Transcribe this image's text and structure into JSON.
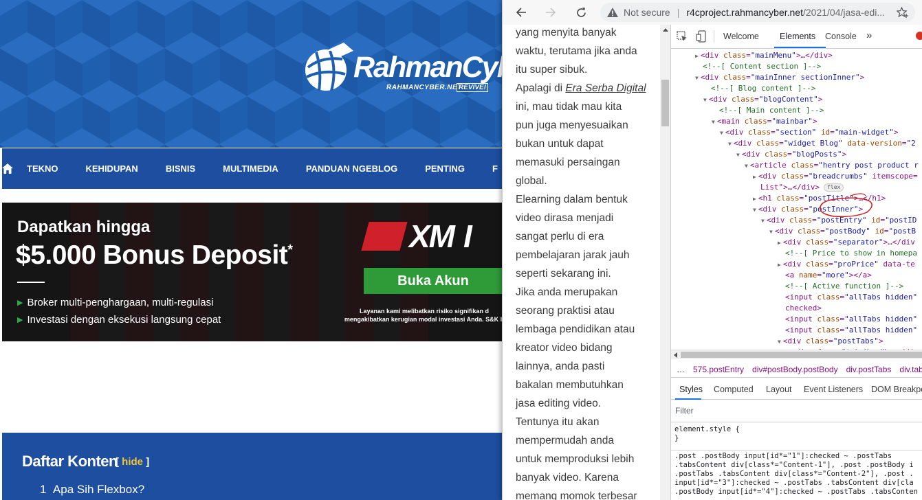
{
  "site": {
    "logo_text": "RahmanCyber",
    "logo_sub": "RAHMANCYBER.NET",
    "logo_revive": "REVIVE!",
    "nav": [
      "TEKNO",
      "KEHIDUPAN",
      "BISNIS",
      "MULTIMEDIA",
      "PANDUAN NGEBLOG",
      "PENTING",
      "F"
    ],
    "ad": {
      "line1": "Dapatkan hingga",
      "line2": "$5.000 Bonus Deposit",
      "star": "*",
      "bullets": [
        "Broker multi-penghargaan, multi-regulasi",
        "Investasi dengan eksekusi langsung cepat"
      ],
      "brand": "XM",
      "brand_suffix": "I",
      "cta": "Buka Akun",
      "disclaimer1": "Layanan kami melibatkan risiko signifikan d",
      "disclaimer2": "mengakibatkan kerugian modal investasi Anda. S&K b"
    },
    "toc": {
      "title": "Daftar Konten",
      "hide_open": "[",
      "hide_label": "hide",
      "hide_close": "]",
      "item1_num": "1",
      "item1_label": "Apa Sih Flexbox?"
    }
  },
  "browser": {
    "not_secure": "Not secure",
    "url_domain": "r4cproject.rahmancyber.net",
    "url_path": "/2021/04/jasa-edi..."
  },
  "reader_lines": [
    "yang menyita banyak",
    "waktu, terutama jika anda",
    "itu super sibuk.",
    "Apalagi di |Era Serba Digital",
    "ini, mau tidak mau kita",
    "pun juga menyesuaikan",
    "bukan untuk dapat",
    "memasuki persaingan",
    "global.",
    "Elearning dalam bentuk",
    "video dirasa menjadi",
    "sangat perlu di era",
    "pembelajaran jarak jauh",
    "seperti sekarang ini.",
    "Jika anda merupakan",
    "seorang praktisi atau",
    "lembaga pendidikan atau",
    "kreator video bidang",
    "lainnya, anda pasti",
    "bakalan membutuhkan",
    "jasa editing video.",
    "Tentunya itu akan",
    "mempermudah anda",
    "untuk memproduksi lebih",
    "banyak video. Karena",
    "memang momok terbesar"
  ],
  "devtools": {
    "tabs": [
      "Welcome",
      "Elements",
      "Console",
      "»"
    ],
    "dom_lines": [
      {
        "t": "tag",
        "text": "<div class=\"mainMenu\">…</div>",
        "indent": 0
      },
      {
        "t": "cm",
        "text": "<!--[ Content section ]-->",
        "indent": 0
      },
      {
        "t": "tag",
        "text": "<div class=\"mainInner sectionInner\">",
        "indent": 0
      },
      {
        "t": "cm",
        "text": "<!--[ Blog content ]-->",
        "indent": 1
      },
      {
        "t": "tag",
        "text": "<div class=\"blogContent\">",
        "indent": 1
      },
      {
        "t": "cm",
        "text": "<!--[ Main content ]-->",
        "indent": 2
      },
      {
        "t": "tag",
        "text": "<main class=\"mainbar\">",
        "indent": 2
      },
      {
        "t": "tag",
        "text": "<div class=\"section\" id=\"main-widget\">",
        "indent": 3
      },
      {
        "t": "tag",
        "text": "<div class=\"widget Blog\" data-version=\"2",
        "indent": 4
      },
      {
        "t": "tag",
        "text": "<div class=\"blogPosts\">",
        "indent": 5
      },
      {
        "t": "tag",
        "text": "<article class=\"hentry post product r",
        "indent": 6
      },
      {
        "t": "tag",
        "text": "<div class=\"breadcrumbs\" itemscope=",
        "indent": 7
      },
      {
        "t": "tx",
        "text": "List\">…</div>",
        "indent": 7
      },
      {
        "t": "tag",
        "text": "<h1 class=\"postTitle\">…</h1>",
        "indent": 7
      },
      {
        "t": "tag",
        "text": "<div class=\"postInner\">",
        "indent": 7
      },
      {
        "t": "tag",
        "text": "<div class=\"postEntry\" id=\"postID",
        "indent": 8
      },
      {
        "t": "tag",
        "text": "<div class=\"postBody\" id=\"postB",
        "indent": 9
      },
      {
        "t": "tag",
        "text": "<div class=\"separator\">…</div",
        "indent": 10
      },
      {
        "t": "cm",
        "text": "<!--[ Price to show in homepa",
        "indent": 10
      },
      {
        "t": "tag",
        "text": "<div class=\"proPrice\" data-te",
        "indent": 10
      },
      {
        "t": "tag",
        "text": "<a name=\"more\"></a>",
        "indent": 10
      },
      {
        "t": "cm",
        "text": "<!--[ Active function ]-->",
        "indent": 10
      },
      {
        "t": "tag",
        "text": "<input class=\"allTabs hidden\"",
        "indent": 10
      },
      {
        "t": "tx",
        "text": "checked>",
        "indent": 10
      },
      {
        "t": "tag",
        "text": "<input class=\"allTabs hidden\"",
        "indent": 10
      },
      {
        "t": "tag",
        "text": "<input class=\"allTabs hidden\"",
        "indent": 10
      },
      {
        "t": "tag",
        "text": "<div class=\"postTabs\">",
        "indent": 10
      },
      {
        "t": "tag",
        "text": "<div class=\"tabsHead\">…</div>",
        "indent": 11
      }
    ],
    "flex_badge": "flex",
    "crumbs": [
      "…",
      "575.postEntry",
      "div#postBody.postBody",
      "div.postTabs",
      "div.tabs"
    ],
    "subtabs": [
      "Styles",
      "Computed",
      "Layout",
      "Event Listeners",
      "DOM Breakpo"
    ],
    "filter_placeholder": "Filter",
    "element_style_open": "element.style {",
    "element_style_close": "}",
    "rule_lines": [
      ".post .postBody input[id*=\"1\"]:checked ~ .postTabs",
      ".tabsContent div[class*=\"Content-1\"], .post .postBody i",
      ".postTabs .tabsContent div[class*=\"Content-2\"], .post .",
      "input[id*=\"3\"]:checked ~ .postTabs .tabsContent div[cla",
      ".postBody input[id*=\"4\"]:checked ~ .postTabs .tabsConten"
    ]
  },
  "colors": {
    "nav_blue": "#1d4ea0",
    "accent_green": "#2e9a38",
    "devtools_blue": "#1a73e8",
    "annotation_red": "#d01a1a"
  }
}
